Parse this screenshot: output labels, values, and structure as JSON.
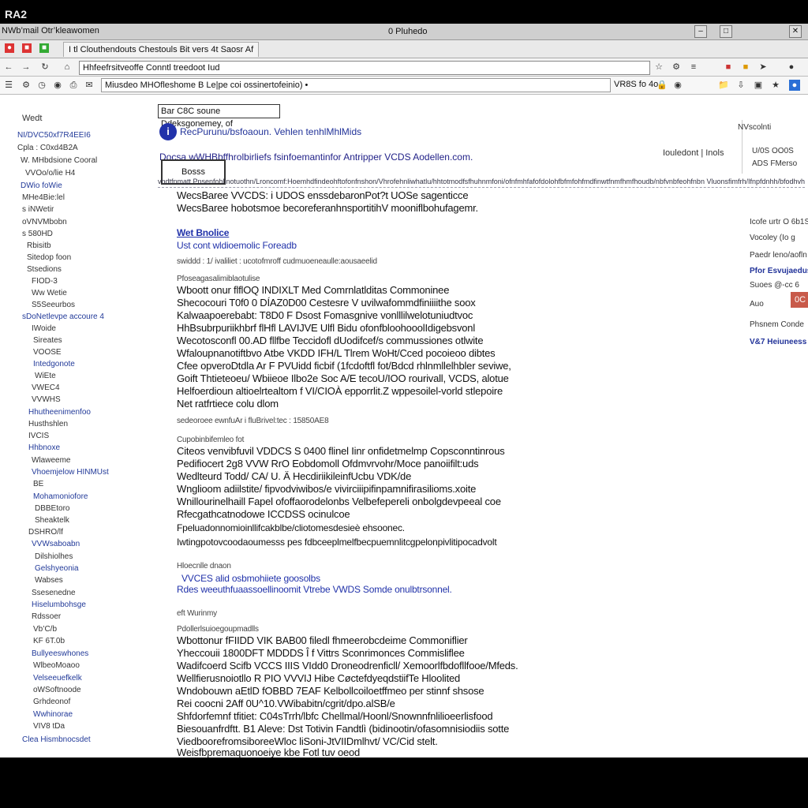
{
  "screen": {
    "label": "RA2"
  },
  "window": {
    "title_left": "NWb’mail Otr’kleawomen",
    "title_center": "0 Pluhedo",
    "controls": [
      "–",
      "□",
      "✕"
    ]
  },
  "tabs": [
    {
      "label": "I tl Clouthendouts Chestouls Bit vers 4t Saosr Af"
    }
  ],
  "address_bar": {
    "value": "Hhfeefrsitveoffe Conntl treedoot Iud"
  },
  "toolbar2": {
    "search_value": "Miusdeo MHOfleshome B  Le|pe coi ossinertofeinio) •",
    "right_text": "VR8S fo 4o"
  },
  "sidebar": {
    "heading": "Wedt",
    "items": [
      "NI/DVC50xf7R4EEI6",
      "Cpla : C0xd4B2A",
      "W. MHbdsione Cooral",
      "VVOo/o/lie H4",
      "DWio foWie",
      "MHe4Bie:lel",
      "s iNWetir",
      "oVNVMbobn",
      "s 580HD",
      "Rbisitb",
      "Sitedop foon",
      "Stsedions",
      "FIOD-3",
      "Ww Wetie",
      "S5Seeurbos",
      "sDoNetlevpe accoure 4",
      "IWoide",
      "Sireates",
      "VOOSE",
      "Intedgonote",
      "WiEte",
      "VWEC4",
      "VVWHS",
      "Hhutheenimenfoo",
      "Husthshlen",
      "IVCIS",
      "Hhbnoxe",
      "Wlaweeme",
      "Vhoemjelow HINMUst",
      "BE",
      "Mohamoniofore",
      "DBBEtoro",
      "Sheaktelk",
      "DSHRO/lf",
      "VVWsaboabn",
      "Dilshiolhes",
      "Gelshyeonia",
      "Wabses",
      "Ssesenedne",
      "Hiselumbohsge",
      "Rdssoer",
      "Vb’C/b",
      "KF 6T.0b",
      "Bullyeeswhones",
      "WlbeoMoaoo",
      "Velseeuefkelk",
      "oWSoftnoode",
      "Grhdeonof",
      "Wwhinorae",
      "VIV8 tDa",
      "Clea Hismbnocsdet"
    ]
  },
  "main": {
    "query": "Bar C8C soune Ddeksgonemey, of",
    "notice_text": "RecPurunu/bsfoaoun. Vehlen tenhlMhlMids",
    "headline": "Docsa wWHBbffhrolbirliefs fsinfoemantinfor Antripper VCDS Aodellen.com.",
    "button_label": "Bosss",
    "pager": "Iouledont | Inols",
    "link_rule": "vhdtfnmatt Pnsenfohlinotuothn/Lroncomf:Hoemhdfindeohftofonfnshon/Vhrofehnliwhatlu/hhtotmodfsfhuhnmfoni/ofnfmhfafofdolohfbfmfohfmdfinwtfnmfhmfhoudb/nbfvnbfeohfnbn Vluonsfimfrh/Ifnpfdnhh/bfodhvhdt/bfmhoffondmt",
    "intro_lines": [
      "WecsBaree VVCDS: i UDOS enssdebaronPot?t UOSe sagenticce",
      "WecsBaree hobotsmoe becoreferanhnsportitihV mooniflbohufagemr."
    ],
    "subhead_title": "Wet Bnolice",
    "subhead_text": "Ust cont wldioemolic Foreadb",
    "meta_line": "swiddd : 1/ ivaliliet :  ucotofmroff cudmuoeneaulle:aousaeelid",
    "section1_label": "Pfoseagasalimiblaotulise",
    "section1_lines": [
      "Wboott onur flflOQ INDIXLT Med Comrnlatlditas Commoninee",
      "Shecocouri T0f0 0 DÍAZ0D00 Cestesre V uvilwafommdfiniiiithe soox",
      "Kalwaapoerebabt: T8D0 F Dsost Fomasgnive vonlllilwelotuniudtvoc",
      "HhBsubrpuriikhbrf flHfl LAVIJVE Ulfl Bidu ofonfbloohooolIdigebsvonl",
      "Wecotosconfl 00.AD fllfbe Teccidofl dUodifcef/s commussiones otlwite",
      "Wfaloupnanotiftbvo Atbe VKDD IFH/L Tlrem WoHt/Cced pocoieoo dibtes",
      "Cfee opveroDtdla Ar F PVUidd ficbif (1fcdoftfl fot/Bdcd rhlnmllelhbler seviwe,",
      "Goift Thtieteoeu/ Wbiieoe Ilbo2e Soc A/E tecoU/IOO rourivall, VCDS, alotue",
      "Helfoerdioun altioelrtealtom f VI/CIOÀ epporrlit.Z wppesoilel-vorld stlepoire",
      "Net ratfrtiece colu dlom"
    ],
    "section1_meta": "sedeoroee ewnfuAr i fluBrivel:tec :      15850AE8",
    "section2_label": "Cupobinbifemleo fot",
    "section2_lines": [
      "Citeos venvibfuvil VDDCS S 0400 flinel Iinr onfidetmelmp Copsconntinrous",
      "Pedifiocert 2g8 VVW RrO Eobdomoll Ofdmvrvohr/Moce panoiifilt:uds",
      "Wedlteurd Todd/ CA/ U. Ä HecdiriikileinfUcbu VDK/de",
      "Wnglioom adiilstite/ fipvodviwibos/e vivirciiipifinpamnifirasilioms.xoite",
      "Wnillourinelhaill Fapel ofoffaorodelonbs Velbefepereli onbolgdevpeeal coe",
      "Rfecgathcatnodowe ICCDSS ocinulcoe"
    ],
    "section2_extra": [
      "Fpeluadonnomioinllifcakblbe/cliotomesdesieè ehsoonec.",
      "Iwtingpotovcoodaoumesss pes fdbceeplmelfbecpuemnlitcgpelonpivlitipocadvolt"
    ],
    "section3_small": "Hloecnlle dnaon",
    "section3_link": "VVCES alid osbmohiiete goosolbs",
    "section3_lines": [
      "Rdes weeuthfuaassoellinoomit Vtrebe VWDS Somde onulbtrsonnel."
    ],
    "section4_label": "eft Wurinmy",
    "section4_small": "Pdollerlsuioegoupmadlls",
    "section4_lines": [
      "Wbottonur fFIIDD VIK BAB00 filedl fhmeerobcdeime Commoniflier",
      "Yheccouii 1800DFT MDDDS Î f Vittrs Sconrimonces Commisliflee",
      "Wadifcoerd Scifb VCCS IIIS VIdd0 Droneodrenficll/ Xemoorlfbdofllfooe/Mfeds.",
      "Wellfierusnoiotllo R PIO VVVIJ Hibe CøctefdyeqdstiifTe Hloolited",
      "Wndobouwn aEtlD fOBBD 7EAF Kelbollcoiloetffmeo per stinnf shsose",
      "Rei coocni 2Aff 0U^10.VWibabitn/cgrit/dpo.alSB/e",
      "Shfdorfemnf tfitiet: C04sTrrh/lbfc Chellmal/Hoonl/Snownnfnlilioeerlisfood",
      "Biesouanfrdftt. B1 Aleve: Dst Totivin Fandtlì (bidinootin/ofasomnisiodiis sotte",
      "ViedboorefromsiboreeWloc liSoni-JtVIIDmlhvt/ VC/Cid stelt.",
      "Weisfbpremaquonoeiye kbe Fotl tuv oeod"
    ]
  },
  "right": {
    "box_lines": [
      "NVscolnti",
      "U/0S  OO0S",
      "ADS  FMerso"
    ],
    "labels": [
      "Icofe urtr O 6b1S",
      "Vocoley  (Io g",
      "Paedr  leno/aofln",
      "Pfor Esvujaedus",
      "Suoes  @-cc 6",
      "Auo",
      "Phsnem  Conde",
      "V&7 Heiuneess"
    ],
    "badge": "0C"
  },
  "colors": {
    "link": "#2233aa",
    "badge": "#c85a4a",
    "chrome": "#cfcfcf"
  }
}
